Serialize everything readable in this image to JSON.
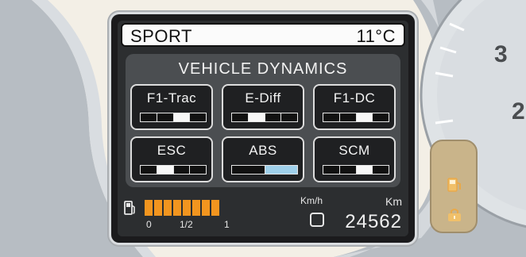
{
  "header": {
    "mode": "SPORT",
    "temperature": "11°C"
  },
  "panel": {
    "title": "VEHICLE DYNAMICS",
    "tiles": [
      {
        "label": "F1-Trac",
        "active_segment": 2,
        "segments": 4,
        "highlight": false
      },
      {
        "label": "E-Diff",
        "active_segment": 1,
        "segments": 4,
        "highlight": false
      },
      {
        "label": "F1-DC",
        "active_segment": 2,
        "segments": 4,
        "highlight": false
      },
      {
        "label": "ESC",
        "active_segment": 1,
        "segments": 4,
        "highlight": false
      },
      {
        "label": "ABS",
        "active_segment": 1,
        "segments": 2,
        "highlight": true
      },
      {
        "label": "SCM",
        "active_segment": 2,
        "segments": 4,
        "highlight": false
      }
    ]
  },
  "bottom": {
    "fuel_scale": {
      "empty": "0",
      "half": "1/2",
      "full": "1"
    },
    "speed_unit": "Km/h",
    "odometer_unit": "Km",
    "odometer": "24562",
    "fuel_cells": 8
  },
  "gauge": {
    "visible_numbers": [
      "3",
      "2"
    ]
  },
  "colors": {
    "fuel": "#f2951f",
    "abs_highlight": "#9fd0ea",
    "side_panel": "#c9b48a"
  },
  "icons": [
    "fuel-pump-icon",
    "fuel-tank-icon",
    "fuel-door-lock-icon"
  ]
}
